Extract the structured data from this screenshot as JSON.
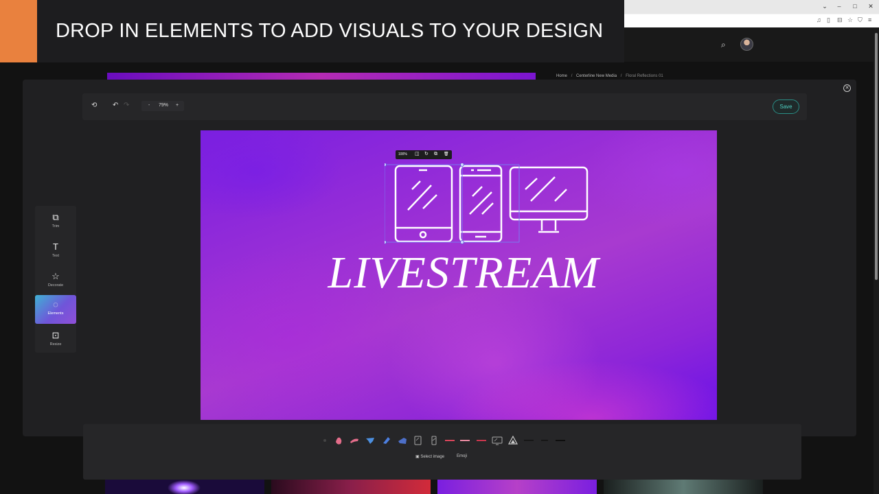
{
  "banner": {
    "text": "DROP IN ELEMENTS TO ADD VISUALS TO YOUR DESIGN",
    "accent_color": "#e9813e"
  },
  "breadcrumb": {
    "items": [
      "Home",
      "Centerline New Media",
      "Floral Reflections 01"
    ],
    "separator": "/"
  },
  "browser": {
    "controls": {
      "minimize": "–",
      "maximize": "□",
      "close": "✕",
      "chevron": "⌄"
    },
    "toolbar_icons": {
      "music": "♫",
      "sidebar": "▯",
      "wallet": "⊟",
      "star": "☆",
      "shield": "⛉",
      "menu": "≡"
    }
  },
  "icons": {
    "search": "⌕",
    "close": "✕",
    "reset": "⟲",
    "undo": "↶",
    "redo": "↷",
    "trim": "⧉",
    "text": "T",
    "star": "☆",
    "elements": "◌",
    "resize": "⊡",
    "duplicate": "⧉",
    "delete": "🗑",
    "flip": "◫",
    "rotate": "↻",
    "image": "▣"
  },
  "toolbar": {
    "zoom_minus": "-",
    "zoom_value": "79%",
    "zoom_plus": "+",
    "save_label": "Save"
  },
  "side_menu": {
    "items": [
      {
        "key": "trim",
        "label": "Trim"
      },
      {
        "key": "text",
        "label": "Text"
      },
      {
        "key": "decorate",
        "label": "Decorate"
      },
      {
        "key": "elements",
        "label": "Elements",
        "active": true
      },
      {
        "key": "resize",
        "label": "Resize"
      }
    ]
  },
  "canvas": {
    "title": "LIVESTREAM",
    "selection_opacity": "100%"
  },
  "elements_bar": {
    "select_image_label": "Select image",
    "emoji_label": "Emoji",
    "thumbnails": [
      "brush-dot",
      "blob-pink",
      "brush-pink",
      "brush-blue",
      "brush-blue-2",
      "brush-blue-3",
      "tablet",
      "phone",
      "line-red",
      "line-pink",
      "line-red-2",
      "monitor",
      "triangle-fractal",
      "line-dark",
      "line-dark-2",
      "line-dark-3"
    ]
  },
  "colors": {
    "accent_teal": "#4fd1c3",
    "canvas_purple": "#8e26d8"
  }
}
